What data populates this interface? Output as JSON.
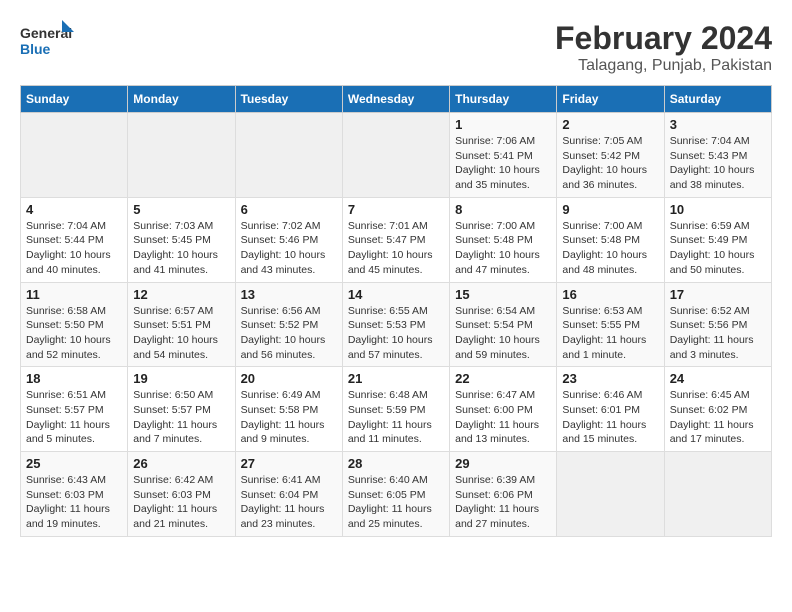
{
  "header": {
    "logo_line1": "General",
    "logo_line2": "Blue",
    "title": "February 2024",
    "subtitle": "Talagang, Punjab, Pakistan"
  },
  "days_of_week": [
    "Sunday",
    "Monday",
    "Tuesday",
    "Wednesday",
    "Thursday",
    "Friday",
    "Saturday"
  ],
  "weeks": [
    [
      {
        "day": "",
        "info": ""
      },
      {
        "day": "",
        "info": ""
      },
      {
        "day": "",
        "info": ""
      },
      {
        "day": "",
        "info": ""
      },
      {
        "day": "1",
        "info": "Sunrise: 7:06 AM\nSunset: 5:41 PM\nDaylight: 10 hours\nand 35 minutes."
      },
      {
        "day": "2",
        "info": "Sunrise: 7:05 AM\nSunset: 5:42 PM\nDaylight: 10 hours\nand 36 minutes."
      },
      {
        "day": "3",
        "info": "Sunrise: 7:04 AM\nSunset: 5:43 PM\nDaylight: 10 hours\nand 38 minutes."
      }
    ],
    [
      {
        "day": "4",
        "info": "Sunrise: 7:04 AM\nSunset: 5:44 PM\nDaylight: 10 hours\nand 40 minutes."
      },
      {
        "day": "5",
        "info": "Sunrise: 7:03 AM\nSunset: 5:45 PM\nDaylight: 10 hours\nand 41 minutes."
      },
      {
        "day": "6",
        "info": "Sunrise: 7:02 AM\nSunset: 5:46 PM\nDaylight: 10 hours\nand 43 minutes."
      },
      {
        "day": "7",
        "info": "Sunrise: 7:01 AM\nSunset: 5:47 PM\nDaylight: 10 hours\nand 45 minutes."
      },
      {
        "day": "8",
        "info": "Sunrise: 7:00 AM\nSunset: 5:48 PM\nDaylight: 10 hours\nand 47 minutes."
      },
      {
        "day": "9",
        "info": "Sunrise: 7:00 AM\nSunset: 5:48 PM\nDaylight: 10 hours\nand 48 minutes."
      },
      {
        "day": "10",
        "info": "Sunrise: 6:59 AM\nSunset: 5:49 PM\nDaylight: 10 hours\nand 50 minutes."
      }
    ],
    [
      {
        "day": "11",
        "info": "Sunrise: 6:58 AM\nSunset: 5:50 PM\nDaylight: 10 hours\nand 52 minutes."
      },
      {
        "day": "12",
        "info": "Sunrise: 6:57 AM\nSunset: 5:51 PM\nDaylight: 10 hours\nand 54 minutes."
      },
      {
        "day": "13",
        "info": "Sunrise: 6:56 AM\nSunset: 5:52 PM\nDaylight: 10 hours\nand 56 minutes."
      },
      {
        "day": "14",
        "info": "Sunrise: 6:55 AM\nSunset: 5:53 PM\nDaylight: 10 hours\nand 57 minutes."
      },
      {
        "day": "15",
        "info": "Sunrise: 6:54 AM\nSunset: 5:54 PM\nDaylight: 10 hours\nand 59 minutes."
      },
      {
        "day": "16",
        "info": "Sunrise: 6:53 AM\nSunset: 5:55 PM\nDaylight: 11 hours\nand 1 minute."
      },
      {
        "day": "17",
        "info": "Sunrise: 6:52 AM\nSunset: 5:56 PM\nDaylight: 11 hours\nand 3 minutes."
      }
    ],
    [
      {
        "day": "18",
        "info": "Sunrise: 6:51 AM\nSunset: 5:57 PM\nDaylight: 11 hours\nand 5 minutes."
      },
      {
        "day": "19",
        "info": "Sunrise: 6:50 AM\nSunset: 5:57 PM\nDaylight: 11 hours\nand 7 minutes."
      },
      {
        "day": "20",
        "info": "Sunrise: 6:49 AM\nSunset: 5:58 PM\nDaylight: 11 hours\nand 9 minutes."
      },
      {
        "day": "21",
        "info": "Sunrise: 6:48 AM\nSunset: 5:59 PM\nDaylight: 11 hours\nand 11 minutes."
      },
      {
        "day": "22",
        "info": "Sunrise: 6:47 AM\nSunset: 6:00 PM\nDaylight: 11 hours\nand 13 minutes."
      },
      {
        "day": "23",
        "info": "Sunrise: 6:46 AM\nSunset: 6:01 PM\nDaylight: 11 hours\nand 15 minutes."
      },
      {
        "day": "24",
        "info": "Sunrise: 6:45 AM\nSunset: 6:02 PM\nDaylight: 11 hours\nand 17 minutes."
      }
    ],
    [
      {
        "day": "25",
        "info": "Sunrise: 6:43 AM\nSunset: 6:03 PM\nDaylight: 11 hours\nand 19 minutes."
      },
      {
        "day": "26",
        "info": "Sunrise: 6:42 AM\nSunset: 6:03 PM\nDaylight: 11 hours\nand 21 minutes."
      },
      {
        "day": "27",
        "info": "Sunrise: 6:41 AM\nSunset: 6:04 PM\nDaylight: 11 hours\nand 23 minutes."
      },
      {
        "day": "28",
        "info": "Sunrise: 6:40 AM\nSunset: 6:05 PM\nDaylight: 11 hours\nand 25 minutes."
      },
      {
        "day": "29",
        "info": "Sunrise: 6:39 AM\nSunset: 6:06 PM\nDaylight: 11 hours\nand 27 minutes."
      },
      {
        "day": "",
        "info": ""
      },
      {
        "day": "",
        "info": ""
      }
    ]
  ]
}
